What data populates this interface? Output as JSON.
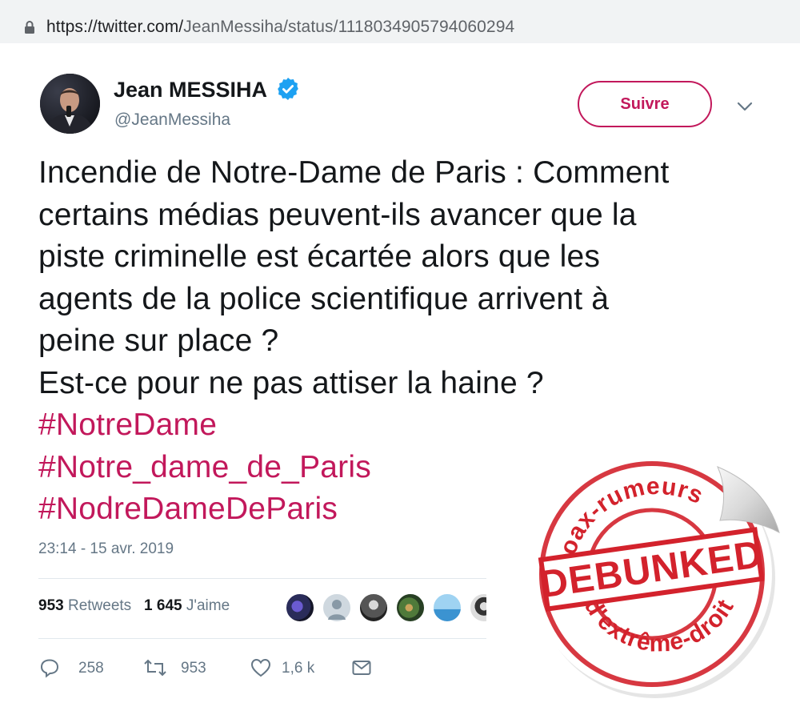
{
  "browser": {
    "url_host": "https://twitter.com/",
    "url_path": "JeanMessiha/status/1118034905794060294"
  },
  "tweet": {
    "author_name": "Jean MESSIHA",
    "author_handle": "@JeanMessiha",
    "follow_label": "Suivre",
    "lines": [
      "Incendie de Notre-Dame de Paris : Comment",
      "certains médias peuvent-ils avancer que la",
      "piste criminelle est écartée alors que les",
      "agents de la police scientifique arrivent à",
      "peine sur place ?",
      "Est-ce pour ne pas attiser la haine ?"
    ],
    "hashtags": [
      "#NotreDame",
      "#Notre_dame_de_Paris",
      "#NodreDameDeParis"
    ],
    "timestamp": "23:14 - 15 avr. 2019",
    "retweets_count": "953",
    "retweets_label": "Retweets",
    "likes_count": "1 645",
    "likes_label": "J'aime",
    "actions": {
      "replies": "258",
      "retweets": "953",
      "likes": "1,6 k"
    }
  },
  "stamp": {
    "top_text": "Hoax-rumeurs",
    "center_text": "DEBUNKED",
    "bottom_text": "d'extrême-droite"
  },
  "colors": {
    "accent": "#c2185b",
    "verified": "#1da1f2",
    "muted": "#657786",
    "stamp_red": "#d3222c"
  },
  "icons": [
    "lock-icon",
    "verified-badge-icon",
    "chevron-down-icon",
    "reply-icon",
    "retweet-icon",
    "like-icon",
    "message-icon"
  ]
}
